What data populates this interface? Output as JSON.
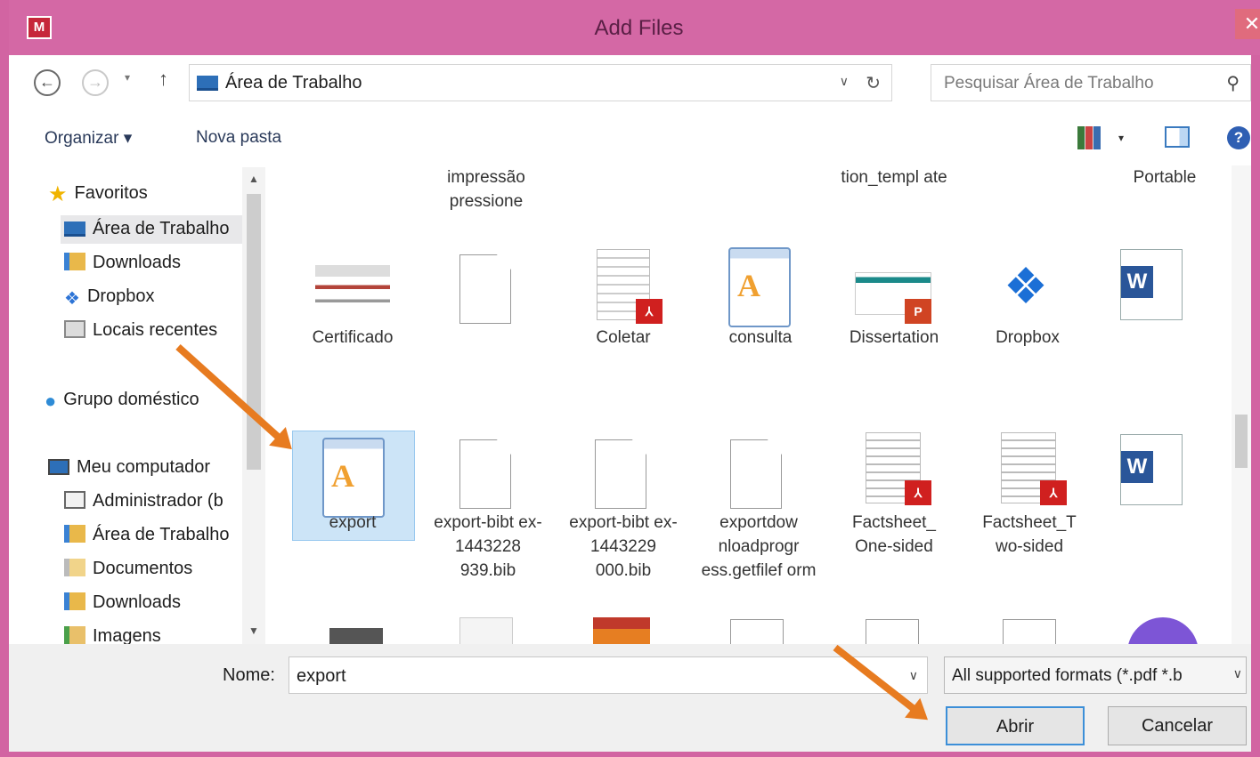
{
  "window": {
    "title": "Add Files",
    "app_logo": "M",
    "close_glyph": "✕"
  },
  "nav": {
    "back_glyph": "←",
    "forward_glyph": "→",
    "history_glyph": "▾",
    "up_glyph": "↑",
    "address": "Área de Trabalho",
    "address_dropdown": "∨",
    "refresh_glyph": "↻",
    "search_placeholder": "Pesquisar Área de Trabalho",
    "search_glyph": "⚲"
  },
  "toolbar": {
    "organize": "Organizar ▾",
    "new_folder": "Nova pasta",
    "view_dropdown": "▾",
    "help_glyph": "?"
  },
  "sidebar": {
    "items": [
      {
        "label": "Favoritos",
        "icon": "star-icon"
      },
      {
        "label": "Área de Trabalho",
        "icon": "desktop-folder-icon"
      },
      {
        "label": "Downloads",
        "icon": "downloads-folder-icon"
      },
      {
        "label": "Dropbox",
        "icon": "dropbox-icon"
      },
      {
        "label": "Locais recentes",
        "icon": "recent-places-icon"
      },
      {
        "label": "Grupo doméstico",
        "icon": "homegroup-icon"
      },
      {
        "label": "Meu computador",
        "icon": "computer-icon"
      },
      {
        "label": "Administrador (b",
        "icon": "user-folder-icon"
      },
      {
        "label": "Área de Trabalho",
        "icon": "desktop-folder-icon"
      },
      {
        "label": "Documentos",
        "icon": "documents-folder-icon"
      },
      {
        "label": "Downloads",
        "icon": "downloads-folder-icon"
      },
      {
        "label": "Imagens",
        "icon": "pictures-folder-icon"
      }
    ]
  },
  "files": {
    "top_row": [
      "impressão pressione",
      "tion_templ ate",
      "Portable"
    ],
    "row1": [
      "Certificado",
      "",
      "Coletar",
      "consulta",
      "Dissertation",
      "Dropbox",
      ""
    ],
    "row2": [
      "export",
      "export-bibt ex-1443228 939.bib",
      "export-bibt ex-1443229 000.bib",
      "exportdow nloadprogr ess.getfilef orm",
      "Factsheet_ One-sided",
      "Factsheet_T wo-sided",
      ""
    ],
    "selected": "export",
    "pdf_badge": "⅄",
    "word_badge": "W",
    "pad_letter": "A"
  },
  "footer": {
    "name_label": "Nome:",
    "name_value": "export",
    "name_dropdown": "∨",
    "filter": "All supported formats (*.pdf *.b",
    "filter_dropdown": "∨",
    "open": "Abrir",
    "cancel": "Cancelar"
  },
  "colors": {
    "titlebar": "#d468a5",
    "arrow": "#e77b20",
    "selection": "#cce4f7",
    "open_border": "#3c8fd8"
  }
}
